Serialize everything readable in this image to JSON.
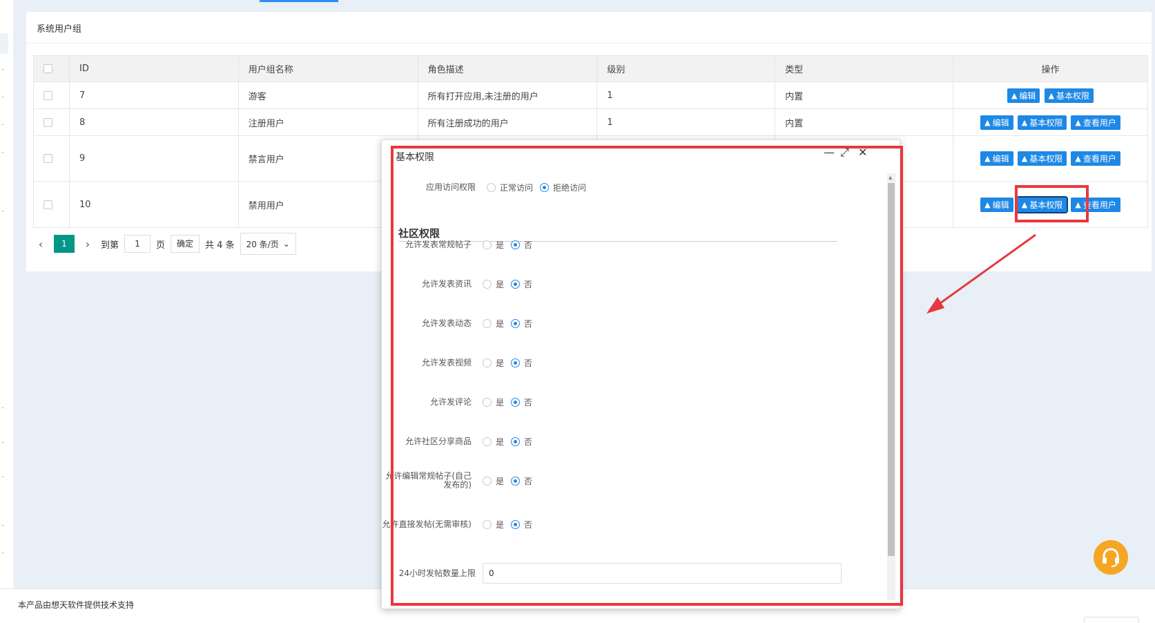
{
  "card": {
    "title": "系统用户组"
  },
  "table": {
    "headers": {
      "id": "ID",
      "name": "用户组名称",
      "desc": "角色描述",
      "level": "级别",
      "type": "类型",
      "ops": "操作"
    },
    "rows": [
      {
        "id": "7",
        "name": "游客",
        "desc": "所有打开应用,未注册的用户",
        "level": "1",
        "type": "内置"
      },
      {
        "id": "8",
        "name": "注册用户",
        "desc": "所有注册成功的用户",
        "level": "1",
        "type": "内置"
      },
      {
        "id": "9",
        "name": "禁言用户",
        "desc": "",
        "level": "",
        "type": ""
      },
      {
        "id": "10",
        "name": "禁用用户",
        "desc": "",
        "level": "",
        "type": ""
      }
    ],
    "btn": {
      "edit": "编辑",
      "perm": "基本权限",
      "users": "查看用户"
    }
  },
  "pager": {
    "current": "1",
    "goto": "到第",
    "page_value": "1",
    "page_unit": "页",
    "confirm": "确定",
    "total": "共 4 条",
    "size": "20 条/页"
  },
  "footer": {
    "text": "本产品由想天软件提供技术支持"
  },
  "dialog": {
    "title": "基本权限",
    "access": {
      "label": "应用访问权限",
      "opt_a": "正常访问",
      "opt_b": "拒绝访问"
    },
    "section": "社区权限",
    "yes": "是",
    "no": "否",
    "rows": [
      {
        "label": "允许发表常规帖子"
      },
      {
        "label": "允许发表资讯"
      },
      {
        "label": "允许发表动态"
      },
      {
        "label": "允许发表视频"
      },
      {
        "label": "允许发评论"
      },
      {
        "label": "允许社区分享商品"
      },
      {
        "label": "允许编辑常规帖子(自己发布的)"
      },
      {
        "label": "允许直接发帖(无需审核)"
      }
    ],
    "limit": {
      "label": "24小时发帖数量上限",
      "value": "0"
    }
  },
  "colors": {
    "accent": "#1e88e5",
    "pager_active": "#009688",
    "highlight": "#e8383d",
    "support": "#f5a623"
  },
  "icons": {
    "warn": "▲",
    "close": "✕",
    "minimize": "—",
    "maximize": "⤢",
    "chevron_left": "‹",
    "chevron_right": "›",
    "chevron_down": "⌄"
  }
}
